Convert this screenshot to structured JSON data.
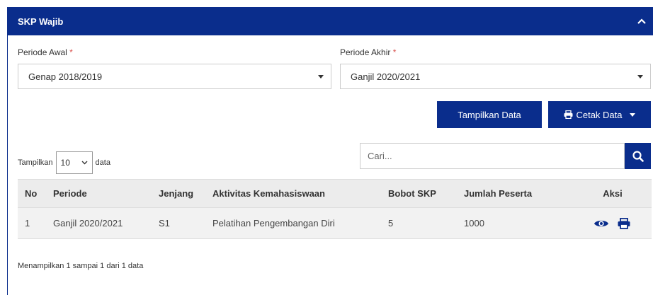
{
  "panel": {
    "title": "SKP Wajib"
  },
  "filters": {
    "periode_awal_label": "Periode Awal",
    "periode_awal_value": "Genap 2018/2019",
    "periode_akhir_label": "Periode Akhir",
    "periode_akhir_value": "Ganjil 2020/2021",
    "required_mark": "*"
  },
  "actions": {
    "show_data": "Tampilkan Data",
    "print_data": "Cetak Data"
  },
  "table_controls": {
    "show_prefix": "Tampilkan",
    "page_length": "10",
    "show_suffix": "data",
    "search_placeholder": "Cari..."
  },
  "table": {
    "headers": [
      "No",
      "Periode",
      "Jenjang",
      "Aktivitas Kemahasiswaan",
      "Bobot SKP",
      "Jumlah Peserta",
      "Aksi"
    ],
    "rows": [
      {
        "no": "1",
        "periode": "Ganjil 2020/2021",
        "jenjang": "S1",
        "aktivitas": "Pelatihan Pengembangan Diri",
        "bobot": "5",
        "peserta": "1000"
      }
    ]
  },
  "footer": {
    "info": "Menampilkan 1 sampai 1 dari 1 data"
  },
  "colors": {
    "primary": "#0a2d8c",
    "required": "#d9534f"
  },
  "icons": {
    "collapse": "chevron-up-icon",
    "print": "print-icon",
    "search": "search-icon",
    "view": "eye-icon"
  }
}
